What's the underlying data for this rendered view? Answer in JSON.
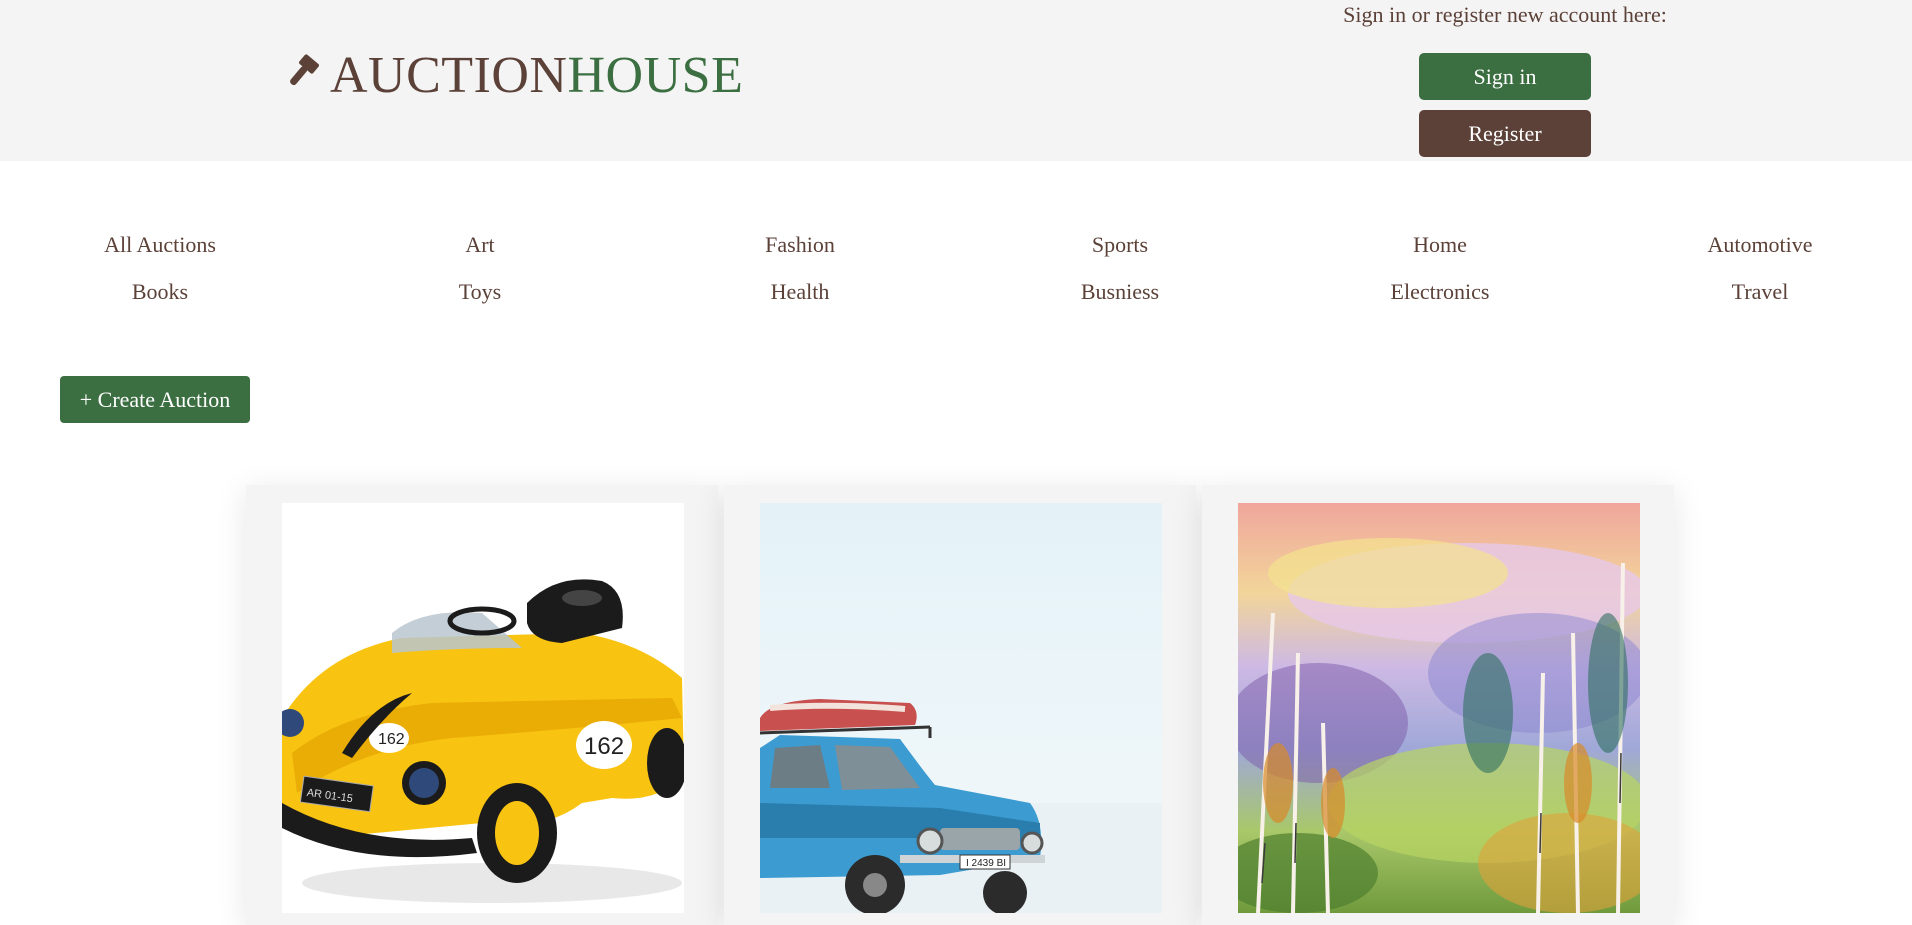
{
  "header": {
    "logo": {
      "part1": "AUCTION",
      "part2": "HOUSE",
      "icon": "gavel-icon"
    },
    "auth_prompt": "Sign in or register new account here:",
    "signin_label": "Sign in",
    "register_label": "Register"
  },
  "categories": {
    "row1": [
      "All Auctions",
      "Art",
      "Fashion",
      "Sports",
      "Home",
      "Automotive"
    ],
    "row2": [
      "Books",
      "Toys",
      "Health",
      "Busniess",
      "Electronics",
      "Travel"
    ]
  },
  "create_auction_label": "+ Create Auction",
  "cards": [
    {
      "image": "yellow-toy-car-image"
    },
    {
      "image": "blue-vintage-car-snow-image"
    },
    {
      "image": "watercolor-forest-painting-image"
    }
  ],
  "colors": {
    "brand_brown": "#5b4138",
    "brand_green": "#3b6e41",
    "header_bg": "#f4f4f4"
  }
}
